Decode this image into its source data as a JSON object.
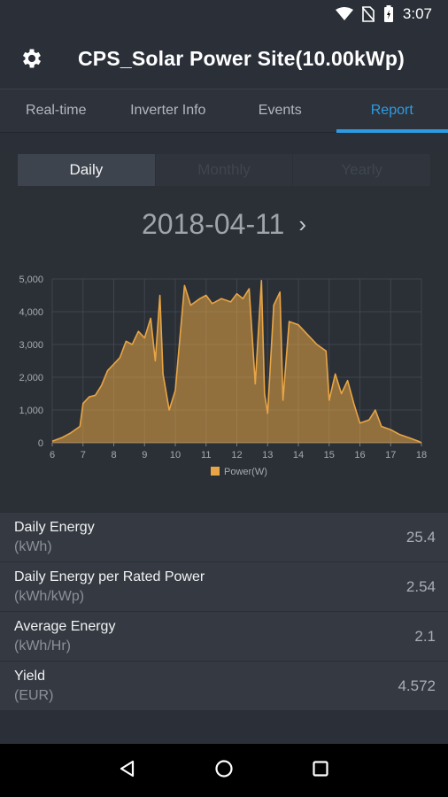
{
  "status": {
    "time": "3:07"
  },
  "app": {
    "title": "CPS_Solar Power Site(10.00kWp)"
  },
  "tabs": [
    {
      "label": "Real-time",
      "active": false
    },
    {
      "label": "Inverter Info",
      "active": false
    },
    {
      "label": "Events",
      "active": false
    },
    {
      "label": "Report",
      "active": true
    }
  ],
  "period_selector": {
    "options": [
      "Daily",
      "Monthly",
      "Yearly"
    ],
    "selected": "Daily"
  },
  "date": {
    "value": "2018-04-11"
  },
  "chart_data": {
    "type": "area",
    "title": "",
    "xlabel": "",
    "ylabel": "",
    "x_ticks": [
      "6",
      "7",
      "8",
      "9",
      "10",
      "11",
      "12",
      "13",
      "14",
      "15",
      "16",
      "17",
      "18"
    ],
    "y_ticks": [
      "0",
      "1,000",
      "2,000",
      "3,000",
      "4,000",
      "5,000"
    ],
    "xlim": [
      6,
      18
    ],
    "ylim": [
      0,
      5000
    ],
    "grid": true,
    "legend_position": "bottom",
    "series": [
      {
        "name": "Power(W)",
        "color": "#e8a545",
        "x": [
          6.0,
          6.3,
          6.6,
          6.9,
          7.0,
          7.2,
          7.4,
          7.6,
          7.8,
          8.0,
          8.2,
          8.4,
          8.6,
          8.8,
          9.0,
          9.2,
          9.35,
          9.5,
          9.6,
          9.8,
          10.0,
          10.3,
          10.5,
          10.8,
          11.0,
          11.2,
          11.5,
          11.8,
          12.0,
          12.2,
          12.4,
          12.6,
          12.8,
          12.9,
          13.0,
          13.2,
          13.4,
          13.5,
          13.7,
          14.0,
          14.3,
          14.6,
          14.9,
          15.0,
          15.2,
          15.4,
          15.6,
          15.8,
          16.0,
          16.3,
          16.5,
          16.7,
          17.0,
          17.3,
          17.6,
          17.9,
          18.0
        ],
        "y": [
          50,
          150,
          300,
          500,
          1200,
          1400,
          1450,
          1750,
          2200,
          2400,
          2600,
          3100,
          3000,
          3400,
          3200,
          3800,
          2500,
          4500,
          2100,
          1000,
          1600,
          4800,
          4200,
          4400,
          4500,
          4250,
          4400,
          4300,
          4550,
          4400,
          4700,
          1800,
          4950,
          1500,
          900,
          4200,
          4600,
          1300,
          3700,
          3600,
          3300,
          3000,
          2800,
          1300,
          2100,
          1500,
          1900,
          1200,
          600,
          700,
          1000,
          500,
          400,
          250,
          150,
          50,
          0
        ]
      }
    ]
  },
  "metrics": [
    {
      "label": "Daily Energy",
      "unit": "(kWh)",
      "value": "25.4"
    },
    {
      "label": "Daily Energy per Rated Power",
      "unit": "(kWh/kWp)",
      "value": "2.54"
    },
    {
      "label": "Average Energy",
      "unit": "(kWh/Hr)",
      "value": "2.1"
    },
    {
      "label": "Yield",
      "unit": "(EUR)",
      "value": "4.572"
    }
  ]
}
